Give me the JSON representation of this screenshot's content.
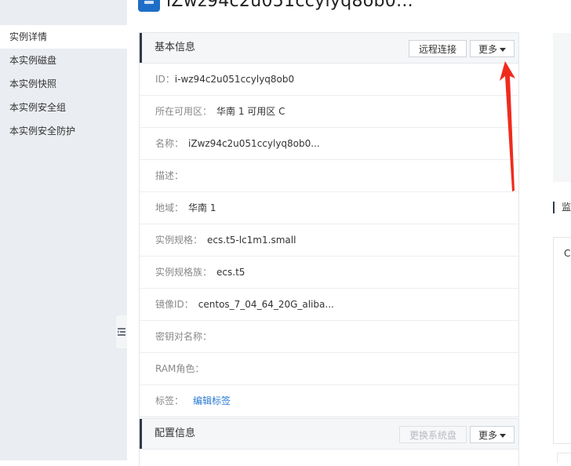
{
  "header": {
    "title": "iZwz94c2u051ccylyq8ob0..."
  },
  "sidebar": {
    "items": [
      {
        "label": "实例详情",
        "active": true
      },
      {
        "label": "本实例磁盘",
        "active": false
      },
      {
        "label": "本实例快照",
        "active": false
      },
      {
        "label": "本实例安全组",
        "active": false
      },
      {
        "label": "本实例安全防护",
        "active": false
      }
    ]
  },
  "basic_info": {
    "title": "基本信息",
    "remote_label": "远程连接",
    "more_label": "更多",
    "rows": [
      {
        "key": "ID：",
        "value": "i-wz94c2u051ccylyq8ob0"
      },
      {
        "key": "所在可用区：",
        "value": "华南 1 可用区 C"
      },
      {
        "key": "名称：",
        "value": "iZwz94c2u051ccylyq8ob0..."
      },
      {
        "key": "描述：",
        "value": ""
      },
      {
        "key": "地域：",
        "value": "华南 1"
      },
      {
        "key": "实例规格：",
        "value": "ecs.t5-lc1m1.small"
      },
      {
        "key": "实例规格族：",
        "value": "ecs.t5"
      },
      {
        "key": "镜像ID：",
        "value": "centos_7_04_64_20G_aliba..."
      },
      {
        "key": "密钥对名称：",
        "value": ""
      },
      {
        "key": "RAM角色：",
        "value": ""
      }
    ],
    "tags_key": "标签：",
    "tags_link": "编辑标签"
  },
  "config_info": {
    "title": "配置信息",
    "change_os_label": "更换系统盘",
    "more_label": "更多"
  },
  "right": {
    "section_label": "监",
    "panel_char": "C"
  },
  "colors": {
    "annotation_arrow": "#f02b1d",
    "link": "#2a7ad4",
    "sidebar_bg": "#eaedf1"
  }
}
